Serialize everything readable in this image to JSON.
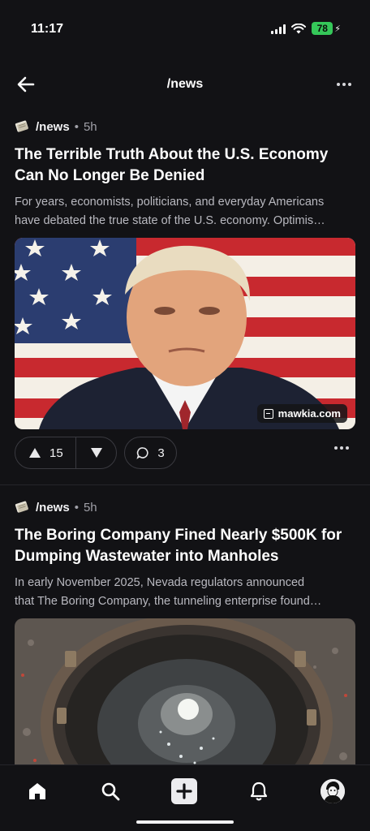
{
  "status_bar": {
    "time": "11:17",
    "battery": "78"
  },
  "header": {
    "title": "/news"
  },
  "posts": [
    {
      "subreddit": "/news",
      "separator": "•",
      "age": "5h",
      "title": "The Terrible Truth About the U.S. Economy Can No Longer Be Denied",
      "snippet_line1": "For years, economists, politicians, and everyday Americans",
      "snippet_line2": "have debated the true state of the U.S. economy. Optimis…",
      "domain": "mawkia.com",
      "upvotes": "15",
      "comments": "3"
    },
    {
      "subreddit": "/news",
      "separator": "•",
      "age": "5h",
      "title": "The Boring Company Fined Nearly $500K for Dumping Wastewater into Manholes",
      "snippet_line1": "In early November 2025, Nevada regulators announced",
      "snippet_line2": "that The Boring Company, the tunneling enterprise found…"
    }
  ],
  "icons": {
    "back": "arrow-left-icon",
    "more": "more-horizontal-icon",
    "upvote": "arrow-up-icon",
    "downvote": "arrow-down-icon",
    "comment": "comment-bubble-icon",
    "home": "home-icon",
    "search": "search-icon",
    "create": "plus-square-icon",
    "notifications": "bell-icon",
    "profile": "avatar"
  },
  "colors": {
    "background": "#121215",
    "battery": "#35c759",
    "text": "#f2f2f4",
    "muted": "#a0a0a8"
  }
}
